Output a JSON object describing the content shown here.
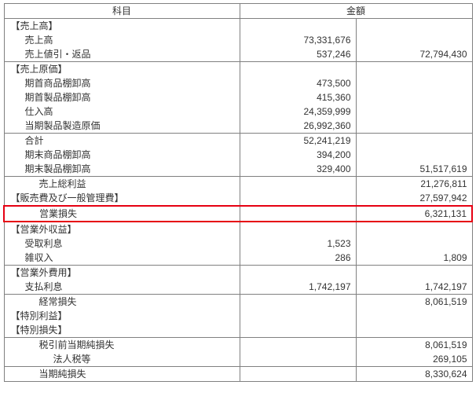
{
  "headers": {
    "item": "科目",
    "amount": "金額"
  },
  "rows": [
    {
      "label": "【売上高】",
      "ind": 0,
      "amt1": "",
      "amt2": "",
      "bb": false,
      "hl": false
    },
    {
      "label": "売上高",
      "ind": 1,
      "amt1": "73,331,676",
      "amt2": "",
      "bb": false,
      "hl": false
    },
    {
      "label": "売上値引・返品",
      "ind": 1,
      "amt1": "537,246",
      "amt2": "72,794,430",
      "bb": true,
      "hl": false
    },
    {
      "label": "【売上原価】",
      "ind": 0,
      "amt1": "",
      "amt2": "",
      "bb": false,
      "hl": false
    },
    {
      "label": "期首商品棚卸高",
      "ind": 1,
      "amt1": "473,500",
      "amt2": "",
      "bb": false,
      "hl": false
    },
    {
      "label": "期首製品棚卸高",
      "ind": 1,
      "amt1": "415,360",
      "amt2": "",
      "bb": false,
      "hl": false
    },
    {
      "label": "仕入高",
      "ind": 1,
      "amt1": "24,359,999",
      "amt2": "",
      "bb": false,
      "hl": false
    },
    {
      "label": "当期製品製造原価",
      "ind": 1,
      "amt1": "26,992,360",
      "amt2": "",
      "bb": true,
      "hl": false
    },
    {
      "label": "合計",
      "ind": 1,
      "amt1": "52,241,219",
      "amt2": "",
      "bb": false,
      "hl": false
    },
    {
      "label": "期末商品棚卸高",
      "ind": 1,
      "amt1": "394,200",
      "amt2": "",
      "bb": false,
      "hl": false
    },
    {
      "label": "期末製品棚卸高",
      "ind": 1,
      "amt1": "329,400",
      "amt2": "51,517,619",
      "bb": true,
      "hl": false
    },
    {
      "label": "売上総利益",
      "ind": 2,
      "amt1": "",
      "amt2": "21,276,811",
      "bb": false,
      "hl": false
    },
    {
      "label": "【販売費及び一般管理費】",
      "ind": 0,
      "amt1": "",
      "amt2": "27,597,942",
      "bb": true,
      "hl": false
    },
    {
      "label": "営業損失",
      "ind": 2,
      "amt1": "",
      "amt2": "6,321,131",
      "bb": false,
      "hl": true
    },
    {
      "label": "【営業外収益】",
      "ind": 0,
      "amt1": "",
      "amt2": "",
      "bb": false,
      "hl": false
    },
    {
      "label": "受取利息",
      "ind": 1,
      "amt1": "1,523",
      "amt2": "",
      "bb": false,
      "hl": false
    },
    {
      "label": "雑収入",
      "ind": 1,
      "amt1": "286",
      "amt2": "1,809",
      "bb": true,
      "hl": false
    },
    {
      "label": "【営業外費用】",
      "ind": 0,
      "amt1": "",
      "amt2": "",
      "bb": false,
      "hl": false
    },
    {
      "label": "支払利息",
      "ind": 1,
      "amt1": "1,742,197",
      "amt2": "1,742,197",
      "bb": true,
      "hl": false
    },
    {
      "label": "経常損失",
      "ind": 2,
      "amt1": "",
      "amt2": "8,061,519",
      "bb": false,
      "hl": false
    },
    {
      "label": "【特別利益】",
      "ind": 0,
      "amt1": "",
      "amt2": "",
      "bb": false,
      "hl": false
    },
    {
      "label": "【特別損失】",
      "ind": 0,
      "amt1": "",
      "amt2": "",
      "bb": true,
      "hl": false
    },
    {
      "label": "税引前当期純損失",
      "ind": 2,
      "amt1": "",
      "amt2": "8,061,519",
      "bb": false,
      "hl": false
    },
    {
      "label": "法人税等",
      "ind": 3,
      "amt1": "",
      "amt2": "269,105",
      "bb": true,
      "hl": false
    },
    {
      "label": "当期純損失",
      "ind": 2,
      "amt1": "",
      "amt2": "8,330,624",
      "bb": true,
      "hl": false
    }
  ]
}
